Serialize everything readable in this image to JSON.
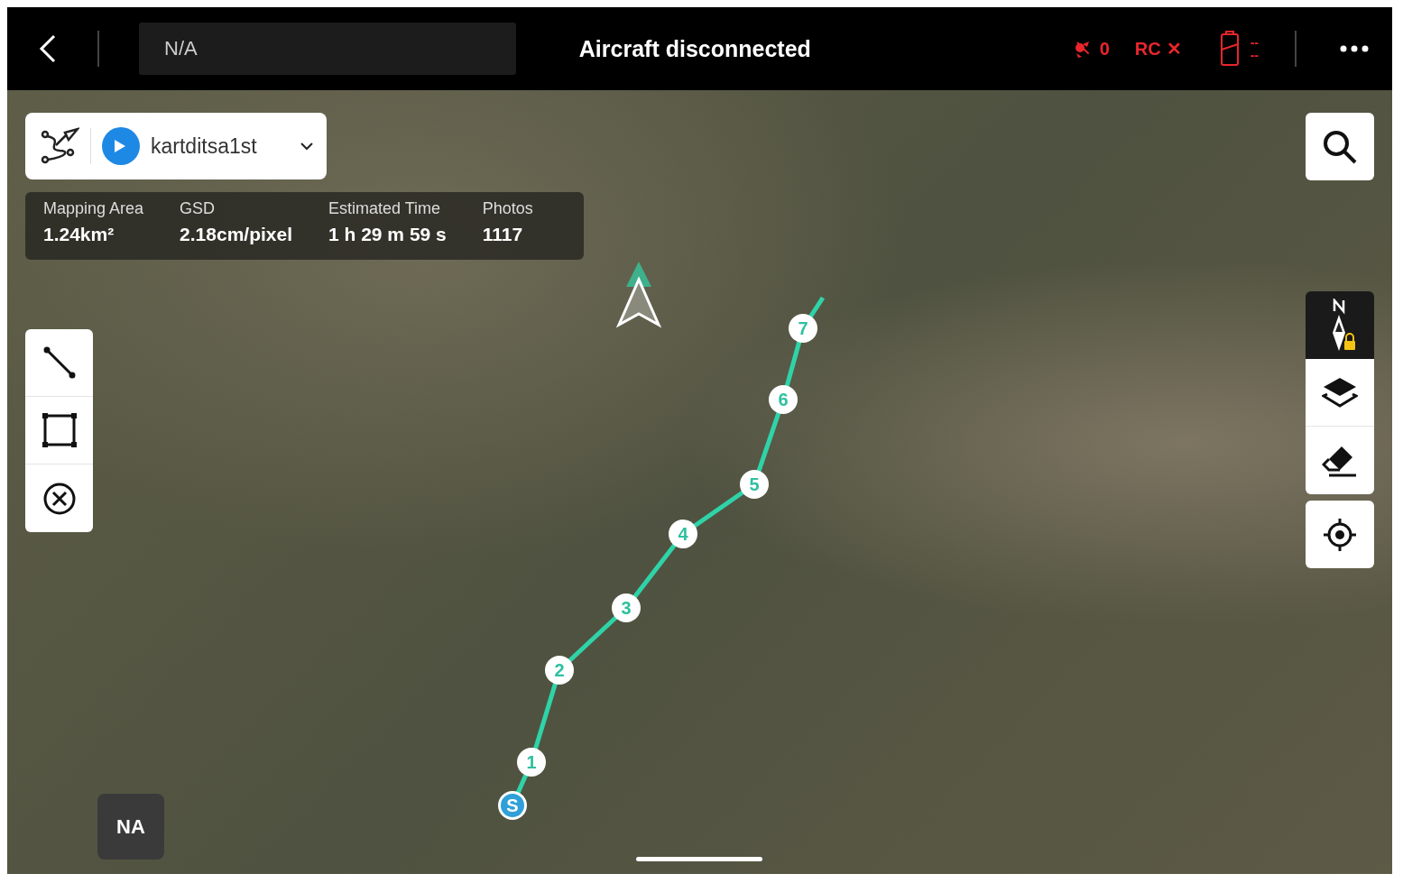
{
  "top_bar": {
    "flight_field": {
      "value": "N/A"
    },
    "title": "Aircraft disconnected",
    "aircraft_count": "0",
    "rc_label": "RC",
    "rc_mark": "✕",
    "battery_readings": [
      "--",
      "--"
    ]
  },
  "mission": {
    "name": "kartditsa1st"
  },
  "stats": [
    {
      "label": "Mapping Area",
      "value": "1.24km²"
    },
    {
      "label": "GSD",
      "value": "2.18cm/pixel"
    },
    {
      "label": "Estimated Time",
      "value": "1 h 29 m 59 s"
    },
    {
      "label": "Photos",
      "value": "1117"
    }
  ],
  "waypoints": [
    {
      "label": "S",
      "kind": "start"
    },
    {
      "label": "1",
      "kind": "waypoint"
    },
    {
      "label": "2",
      "kind": "waypoint"
    },
    {
      "label": "3",
      "kind": "waypoint"
    },
    {
      "label": "4",
      "kind": "waypoint"
    },
    {
      "label": "5",
      "kind": "waypoint"
    },
    {
      "label": "6",
      "kind": "waypoint"
    },
    {
      "label": "7",
      "kind": "waypoint"
    }
  ],
  "camera_badge": "NA"
}
